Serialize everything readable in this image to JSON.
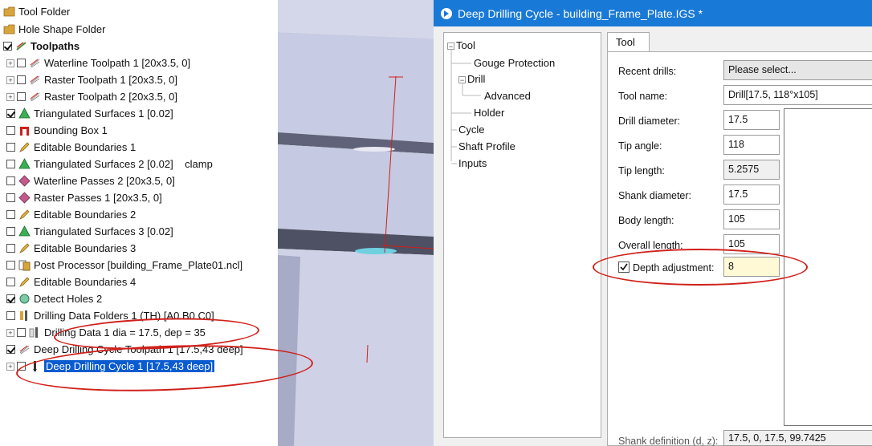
{
  "tree": {
    "items": [
      {
        "label": "Tool Folder",
        "icon": "folder-icon"
      },
      {
        "label": "Hole Shape Folder",
        "icon": "folder-icon"
      },
      {
        "label": "Toolpaths",
        "icon": "toolpaths-icon",
        "checked": true
      },
      {
        "label": "Waterline Toolpath 1 [20x3.5, 0]",
        "icon": "toolpath-icon",
        "checked": false
      },
      {
        "label": "Raster Toolpath 1 [20x3.5, 0]",
        "icon": "toolpath-icon",
        "checked": false
      },
      {
        "label": "Raster Toolpath 2 [20x3.5, 0]",
        "icon": "toolpath-icon",
        "checked": false
      },
      {
        "label": "Triangulated Surfaces 1 [0.02]",
        "icon": "triangulated-surface-icon",
        "checked": true
      },
      {
        "label": "Bounding Box 1",
        "icon": "bounding-box-icon",
        "checked": false
      },
      {
        "label": "Editable Boundaries 1",
        "icon": "pencil-icon",
        "checked": false
      },
      {
        "label": "Triangulated Surfaces 2 [0.02]    clamp",
        "icon": "triangulated-surface-icon",
        "checked": false
      },
      {
        "label": "Waterline Passes 2 [20x3.5, 0]",
        "icon": "passes-icon",
        "checked": false
      },
      {
        "label": "Raster Passes 1 [20x3.5, 0]",
        "icon": "passes-icon",
        "checked": false
      },
      {
        "label": "Editable Boundaries 2",
        "icon": "pencil-icon",
        "checked": false
      },
      {
        "label": "Triangulated Surfaces 3 [0.02]",
        "icon": "triangulated-surface-icon",
        "checked": false
      },
      {
        "label": "Editable Boundaries 3",
        "icon": "pencil-icon",
        "checked": false
      },
      {
        "label": "Post Processor [building_Frame_Plate01.ncl]",
        "icon": "post-processor-icon",
        "checked": false
      },
      {
        "label": "Editable Boundaries 4",
        "icon": "pencil-icon",
        "checked": false
      },
      {
        "label": "Detect Holes 2",
        "icon": "detect-holes-icon",
        "checked": true
      },
      {
        "label": "Drilling Data Folders 1 (TH) [A0 B0 C0]",
        "icon": "drill-folder-icon",
        "checked": false
      },
      {
        "label": "Drilling Data 1 dia = 17.5, dep = 35",
        "icon": "drilling-data-icon",
        "checked": false
      },
      {
        "label": "Deep Drilling Cycle Toolpath 1 [17.5,43 deep]",
        "icon": "toolpath-icon",
        "checked": true
      },
      {
        "label": "Deep Drilling Cycle 1 [17.5,43 deep]",
        "icon": "drill-cycle-icon",
        "checked": false
      }
    ]
  },
  "dialog": {
    "title": "Deep Drilling Cycle  - building_Frame_Plate.IGS *",
    "nav": {
      "items": [
        "Tool",
        "Gouge Protection",
        "Drill",
        "Advanced",
        "Holder",
        "Cycle",
        "Shaft Profile",
        "Inputs"
      ]
    },
    "tab": "Tool",
    "fields": {
      "recent_drills_label": "Recent drills:",
      "recent_drills_value": "Please select...",
      "tool_name_label": "Tool name:",
      "tool_name_value": "Drill[17.5, 118°x105]",
      "drill_diameter_label": "Drill diameter:",
      "drill_diameter_value": "17.5",
      "tip_angle_label": "Tip angle:",
      "tip_angle_value": "118",
      "tip_length_label": "Tip length:",
      "tip_length_value": "5.2575",
      "shank_diameter_label": "Shank diameter:",
      "shank_diameter_value": "17.5",
      "body_length_label": "Body length:",
      "body_length_value": "105",
      "overall_length_label": "Overall length:",
      "overall_length_value": "105",
      "depth_adjustment_label": "Depth adjustment:",
      "depth_adjustment_checked": true,
      "depth_adjustment_value": "8",
      "shank_definition_label": "Shank definition (d, z):",
      "shank_definition_value": "17.5, 0, 17.5, 99.7425"
    }
  },
  "colors": {
    "annotation_red": "#d0201a",
    "selection_blue": "#0a5bd0",
    "titlebar_blue": "#1979d6"
  }
}
